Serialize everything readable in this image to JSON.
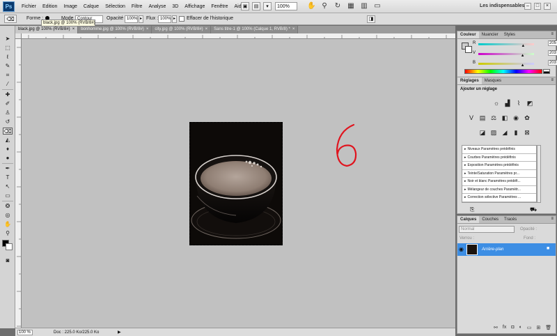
{
  "menubar": {
    "logo": "Ps",
    "items": [
      "Fichier",
      "Edition",
      "Image",
      "Calque",
      "Sélection",
      "Filtre",
      "Analyse",
      "3D",
      "Affichage",
      "Fenêtre",
      "Aide"
    ],
    "zoom_value": "100%",
    "workspace": "Les indispensables"
  },
  "options_bar": {
    "forme_label": "Forme :",
    "mode_label": "Mode :",
    "mode_value": "Contour",
    "opacite_label": "Opacité :",
    "opacite_value": "100%",
    "flux_label": "Flux :",
    "flux_value": "100%",
    "effacer_label": "Effacer de l'historique",
    "tooltip": "black.jpg @ 100% (RVB/8#)"
  },
  "tabs": [
    {
      "label": "black.jpg @ 100% (RVB/8#)",
      "close": "×"
    },
    {
      "label": "bonhomme.jpg @ 100% (RVB/8#)",
      "close": "×"
    },
    {
      "label": "city.jpg @ 100% (RVB/8#)",
      "close": "×"
    },
    {
      "label": "Sans titre-1 @ 100% (Calque 1, RVB/8) *",
      "close": "×"
    }
  ],
  "annotation": {
    "text": "6",
    "color": "#e0141e"
  },
  "statusbar": {
    "zoom": "100 %",
    "doc": "Doc : 225.0 Ko/225.0 Ko",
    "arrow": "▶"
  },
  "color_panel": {
    "tabs": [
      "Couleur",
      "Nuancier",
      "Styles"
    ],
    "channels": [
      {
        "label": "R",
        "value": "205",
        "level": 205
      },
      {
        "label": "V",
        "value": "203",
        "level": 203
      },
      {
        "label": "B",
        "value": "203",
        "level": 203
      }
    ]
  },
  "adjust_panel": {
    "tabs": [
      "Réglages",
      "Masques"
    ],
    "title": "Ajouter un réglage",
    "presets": [
      "Niveaux Paramètres prédéfinis",
      "Courbes Paramètres prédéfinis",
      "Exposition Paramètres prédéfinis",
      "Teinte/Saturation Paramètres pr...",
      "Noir et blanc Paramètres prédéfi...",
      "Mélangeur de couches Paramètr...",
      "Correction sélective Paramètres ..."
    ]
  },
  "layers_panel": {
    "tabs": [
      "Calques",
      "Couches",
      "Tracés"
    ],
    "mode": "Normal",
    "opacity_label": "Opacité :",
    "lock_label": "Verrou :",
    "fill_label": "Fond :",
    "layer_name": "Arrière-plan"
  },
  "colors": {
    "layer_selected": "#3d8ee4",
    "canvas_bg": "#c1c1c1",
    "annotation": "#e0141e"
  }
}
